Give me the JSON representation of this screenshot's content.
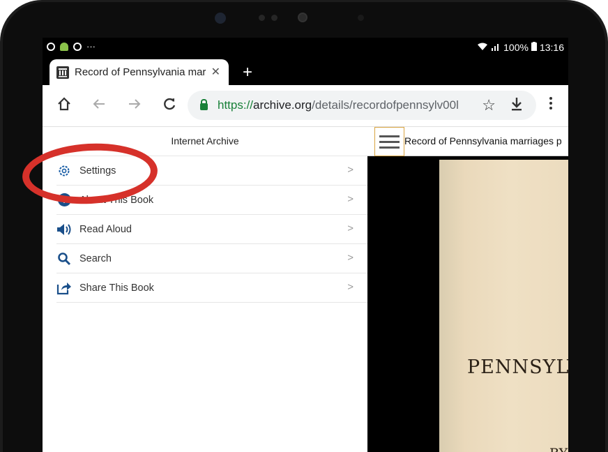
{
  "status_bar": {
    "notifications": "···",
    "battery_percent": "100%",
    "time": "13:16"
  },
  "browser": {
    "tab_title": "Record of Pennsylvania mar",
    "tab_close": "✕",
    "new_tab": "+",
    "url_scheme": "https://",
    "url_host": "archive.org",
    "url_path": "/details/recordofpennsylv00l"
  },
  "side_panel": {
    "header": "Internet Archive",
    "items": [
      {
        "label": "Settings",
        "icon": "gear-icon"
      },
      {
        "label": "About This Book",
        "icon": "info-icon"
      },
      {
        "label": "Read Aloud",
        "icon": "speaker-icon"
      },
      {
        "label": "Search",
        "icon": "search-icon"
      },
      {
        "label": "Share This Book",
        "icon": "share-icon"
      }
    ]
  },
  "reader": {
    "title": "Record of Pennsylvania marriages p",
    "page_word": "PENNSYLV",
    "page_sub": "BY"
  },
  "colors": {
    "annotation": "#d6312a",
    "icon_blue": "#1a5ea6",
    "url_green": "#188038"
  }
}
